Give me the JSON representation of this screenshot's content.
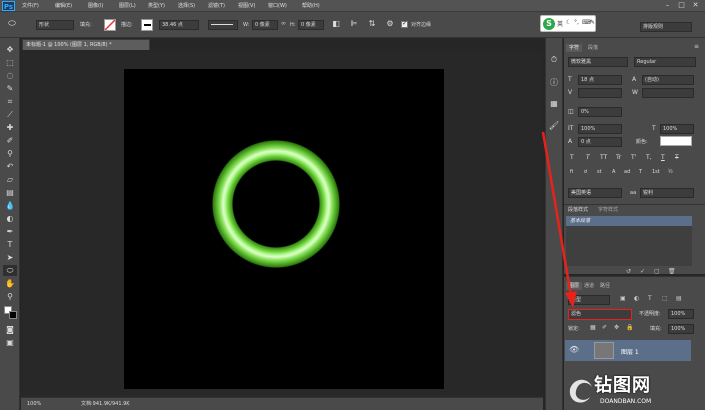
{
  "app": {
    "logo": "Ps"
  },
  "menubar": {
    "items": [
      "文件(F)",
      "编辑(E)",
      "图像(I)",
      "图层(L)",
      "类型(Y)",
      "选择(S)",
      "滤镜(T)",
      "视图(V)",
      "窗口(W)",
      "帮助(H)"
    ]
  },
  "options": {
    "shape_mode": "形状",
    "fill_label": "填充:",
    "stroke_label": "描边:",
    "stroke_width": "38.46 点",
    "w_label": "W:",
    "w_value": "0 像素",
    "h_label": "H:",
    "h_value": "0 像素",
    "align_edges_label": "对齐边缘",
    "workspace": "排版规则"
  },
  "document": {
    "tab_title": "未标题-1 @ 100% (图层 1, RGB/8) *",
    "zoom": "100%",
    "doc_info": "文档:941.9K/941.9K"
  },
  "colors": {
    "accent_arrow": "#e8221a",
    "bracelet": "#6fd63b"
  },
  "character": {
    "tab_character": "字符",
    "tab_paragraph": "段落",
    "font_family": "微软雅黑",
    "font_style": "Regular",
    "font_size": "18 点",
    "leading": "(自动)",
    "tracking": "0%",
    "vscale": "100%",
    "hscale": "100%",
    "baseline": "0 点",
    "color_label": "颜色:",
    "language": "美国英语",
    "aa_label": "aa",
    "aa_mode": "锐利",
    "style_buttons": [
      "T",
      "T",
      "TT",
      "Tr",
      "T'",
      "T,",
      "T",
      "T"
    ],
    "opentype_buttons": [
      "fi",
      "ơ",
      "st",
      "A",
      "ad",
      "T",
      "1st",
      "½"
    ]
  },
  "paragraph_styles": {
    "tab_paragraph_styles": "段落样式",
    "tab_char_styles": "字符样式",
    "base_style": "基本段落"
  },
  "layers": {
    "tab_layers": "图层",
    "tab_channels": "通道",
    "tab_paths": "路径",
    "filter_kind": "类型",
    "blend_mode": "滤色",
    "opacity_label": "不透明度:",
    "opacity_value": "100%",
    "lock_label": "锁定:",
    "fill_label": "填充:",
    "fill_value": "100%",
    "layer_name": "图层 1"
  },
  "watermark": {
    "text": "钻图网",
    "url": "DOANDBAN.COM"
  }
}
